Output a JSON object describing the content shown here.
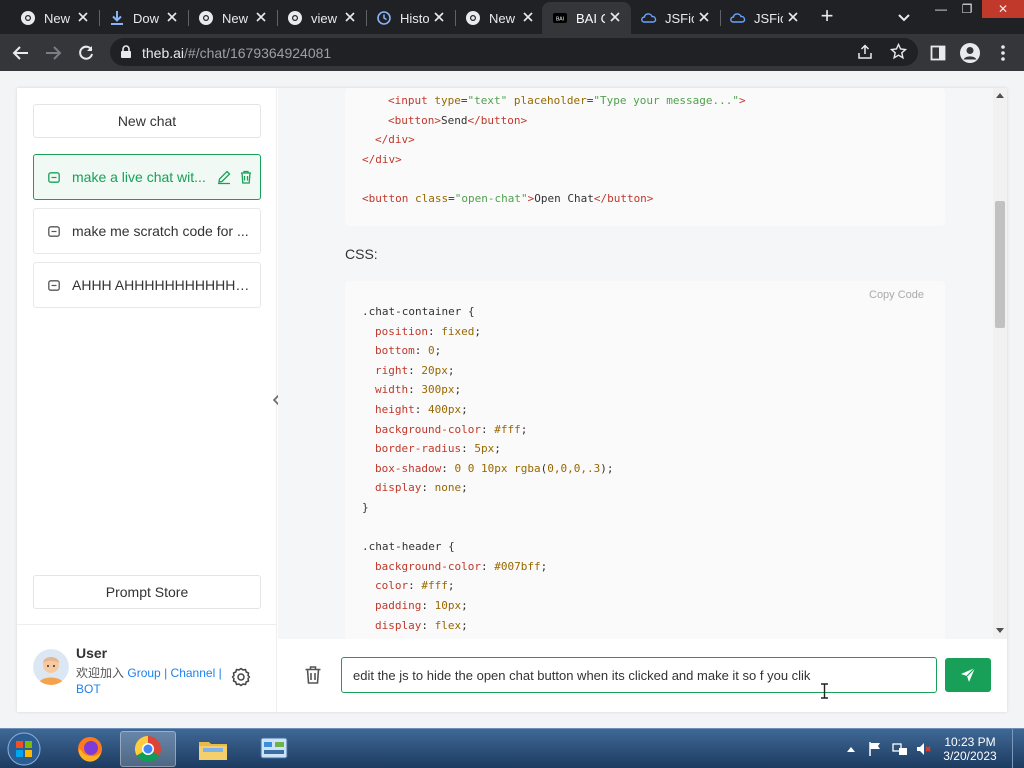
{
  "browser": {
    "tabs": [
      {
        "label": "New",
        "icon": "chrome-icon",
        "active": false
      },
      {
        "label": "Dow",
        "icon": "download-icon",
        "active": false
      },
      {
        "label": "New",
        "icon": "chrome-icon",
        "active": false
      },
      {
        "label": "view",
        "icon": "chrome-icon",
        "active": false
      },
      {
        "label": "Histo",
        "icon": "history-icon",
        "active": false
      },
      {
        "label": "New",
        "icon": "chrome-icon",
        "active": false
      },
      {
        "label": "BAI C",
        "icon": "bai-icon",
        "active": true
      },
      {
        "label": "JSFic",
        "icon": "jsfiddle-icon",
        "active": false
      },
      {
        "label": "JSFic",
        "icon": "jsfiddle-icon",
        "active": false
      }
    ],
    "url_host": "theb.ai",
    "url_path": "/#/chat/1679364924081"
  },
  "sidebar": {
    "new_chat_label": "New chat",
    "chats": [
      {
        "label": "make a live chat wit...",
        "active": true
      },
      {
        "label": "make me scratch code for ...",
        "active": false
      },
      {
        "label": "AHHH AHHHHHHHHHHHH...",
        "active": false
      }
    ],
    "prompt_store_label": "Prompt Store",
    "user": {
      "name": "User",
      "welcome": "欢迎加入",
      "link_group": "Group",
      "link_channel": "Channel",
      "link_bot": "BOT",
      "separator": "|"
    }
  },
  "chat": {
    "html_code_lines": [
      {
        "indent": 2,
        "parts": [
          [
            "tag",
            "<input "
          ],
          [
            "attr",
            "type"
          ],
          [
            "sel",
            "="
          ],
          [
            "str",
            "\"text\""
          ],
          [
            "sel",
            " "
          ],
          [
            "attr",
            "placeholder"
          ],
          [
            "sel",
            "="
          ],
          [
            "str",
            "\"Type your message...\""
          ],
          [
            "tag",
            ">"
          ]
        ]
      },
      {
        "indent": 2,
        "parts": [
          [
            "tag",
            "<button>"
          ],
          [
            "sel",
            "Send"
          ],
          [
            "tag",
            "</button>"
          ]
        ]
      },
      {
        "indent": 1,
        "parts": [
          [
            "tag",
            "</div>"
          ]
        ]
      },
      {
        "indent": 0,
        "parts": [
          [
            "tag",
            "</div>"
          ]
        ]
      },
      {
        "indent": 0,
        "parts": []
      },
      {
        "indent": 0,
        "parts": [
          [
            "tag",
            "<button "
          ],
          [
            "attr",
            "class"
          ],
          [
            "sel",
            "="
          ],
          [
            "str",
            "\"open-chat\""
          ],
          [
            "tag",
            ">"
          ],
          [
            "sel",
            "Open Chat"
          ],
          [
            "tag",
            "</button>"
          ]
        ]
      }
    ],
    "css_label": "CSS:",
    "copy_label": "Copy  Code",
    "css_code_lines": [
      {
        "indent": 0,
        "parts": [
          [
            "sel",
            ".chat-container {"
          ]
        ]
      },
      {
        "indent": 1,
        "parts": [
          [
            "prop",
            "position"
          ],
          [
            "sel",
            ": "
          ],
          [
            "val",
            "fixed"
          ],
          [
            "sel",
            ";"
          ]
        ]
      },
      {
        "indent": 1,
        "parts": [
          [
            "prop",
            "bottom"
          ],
          [
            "sel",
            ": "
          ],
          [
            "num",
            "0"
          ],
          [
            "sel",
            ";"
          ]
        ]
      },
      {
        "indent": 1,
        "parts": [
          [
            "prop",
            "right"
          ],
          [
            "sel",
            ": "
          ],
          [
            "num",
            "20px"
          ],
          [
            "sel",
            ";"
          ]
        ]
      },
      {
        "indent": 1,
        "parts": [
          [
            "prop",
            "width"
          ],
          [
            "sel",
            ": "
          ],
          [
            "num",
            "300px"
          ],
          [
            "sel",
            ";"
          ]
        ]
      },
      {
        "indent": 1,
        "parts": [
          [
            "prop",
            "height"
          ],
          [
            "sel",
            ": "
          ],
          [
            "num",
            "400px"
          ],
          [
            "sel",
            ";"
          ]
        ]
      },
      {
        "indent": 1,
        "parts": [
          [
            "prop",
            "background-color"
          ],
          [
            "sel",
            ": "
          ],
          [
            "val",
            "#fff"
          ],
          [
            "sel",
            ";"
          ]
        ]
      },
      {
        "indent": 1,
        "parts": [
          [
            "prop",
            "border-radius"
          ],
          [
            "sel",
            ": "
          ],
          [
            "num",
            "5px"
          ],
          [
            "sel",
            ";"
          ]
        ]
      },
      {
        "indent": 1,
        "parts": [
          [
            "prop",
            "box-shadow"
          ],
          [
            "sel",
            ": "
          ],
          [
            "num",
            "0 0 10px "
          ],
          [
            "val",
            "rgba"
          ],
          [
            "sel",
            "("
          ],
          [
            "num",
            "0,0,0,.3"
          ],
          [
            "sel",
            ");"
          ]
        ]
      },
      {
        "indent": 1,
        "parts": [
          [
            "prop",
            "display"
          ],
          [
            "sel",
            ": "
          ],
          [
            "val",
            "none"
          ],
          [
            "sel",
            ";"
          ]
        ]
      },
      {
        "indent": 0,
        "parts": [
          [
            "sel",
            "}"
          ]
        ]
      },
      {
        "indent": 0,
        "parts": []
      },
      {
        "indent": 0,
        "parts": [
          [
            "sel",
            ".chat-header {"
          ]
        ]
      },
      {
        "indent": 1,
        "parts": [
          [
            "prop",
            "background-color"
          ],
          [
            "sel",
            ": "
          ],
          [
            "val",
            "#007bff"
          ],
          [
            "sel",
            ";"
          ]
        ]
      },
      {
        "indent": 1,
        "parts": [
          [
            "prop",
            "color"
          ],
          [
            "sel",
            ": "
          ],
          [
            "val",
            "#fff"
          ],
          [
            "sel",
            ";"
          ]
        ]
      },
      {
        "indent": 1,
        "parts": [
          [
            "prop",
            "padding"
          ],
          [
            "sel",
            ": "
          ],
          [
            "num",
            "10px"
          ],
          [
            "sel",
            ";"
          ]
        ]
      },
      {
        "indent": 1,
        "parts": [
          [
            "prop",
            "display"
          ],
          [
            "sel",
            ": "
          ],
          [
            "val",
            "flex"
          ],
          [
            "sel",
            ";"
          ]
        ]
      }
    ],
    "input_value": "edit the js to hide the open chat button when its clicked and make it so f you clik"
  },
  "taskbar": {
    "apps": [
      "firefox-icon",
      "chrome-icon",
      "explorer-icon",
      "control-panel-icon"
    ],
    "time": "10:23 PM",
    "date": "3/20/2023"
  },
  "colors": {
    "accent": "#18a058",
    "link": "#2080f0",
    "tabstrip": "#202124",
    "toolbar": "#35363a"
  }
}
